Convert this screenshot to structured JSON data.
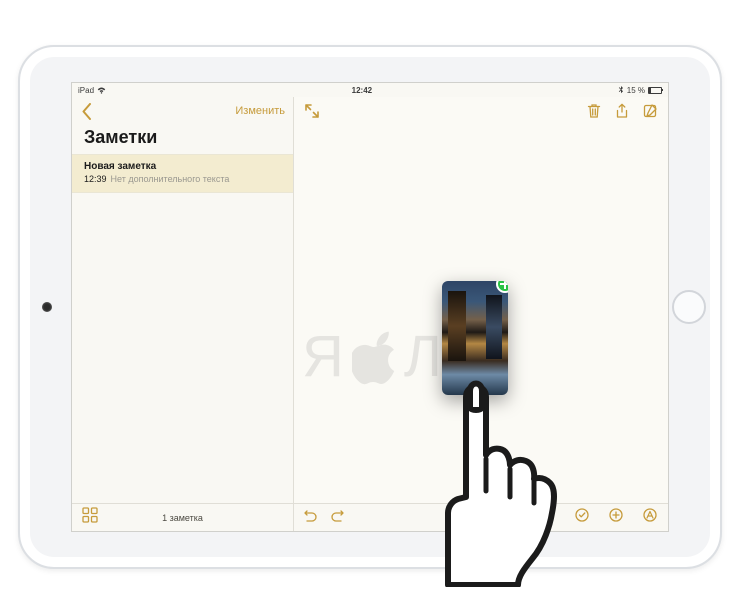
{
  "status": {
    "carrier": "iPad",
    "time": "12:42",
    "battery_text": "15 %"
  },
  "sidebar": {
    "edit_label": "Изменить",
    "title": "Заметки",
    "note": {
      "title": "Новая заметка",
      "time": "12:39",
      "preview": "Нет дополнительного текста"
    },
    "count_label": "1 заметка"
  },
  "editor": {
    "drag_badge": "add",
    "watermark_left": "Я",
    "watermark_right": "Л"
  },
  "colors": {
    "accent": "#c69b3b",
    "selected_row": "#f3ecd0",
    "badge_green": "#29c245"
  }
}
